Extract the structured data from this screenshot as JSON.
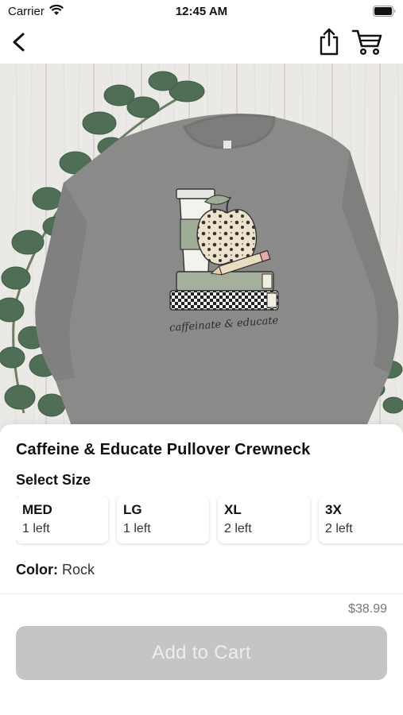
{
  "status_bar": {
    "carrier": "Carrier",
    "time": "12:45 AM"
  },
  "product": {
    "title": "Caffeine & Educate Pullover Crewneck",
    "image_alt": "caffeinate & educate",
    "garment_color": "#8a8a89"
  },
  "size_section": {
    "heading": "Select Size",
    "options": [
      {
        "label": "MED",
        "stock": "1 left"
      },
      {
        "label": "LG",
        "stock": "1 left"
      },
      {
        "label": "XL",
        "stock": "2 left"
      },
      {
        "label": "3X",
        "stock": "2 left"
      }
    ]
  },
  "color_section": {
    "label": "Color:",
    "value": "Rock"
  },
  "price": "$38.99",
  "add_to_cart": {
    "label": "Add to Cart",
    "enabled": false
  }
}
